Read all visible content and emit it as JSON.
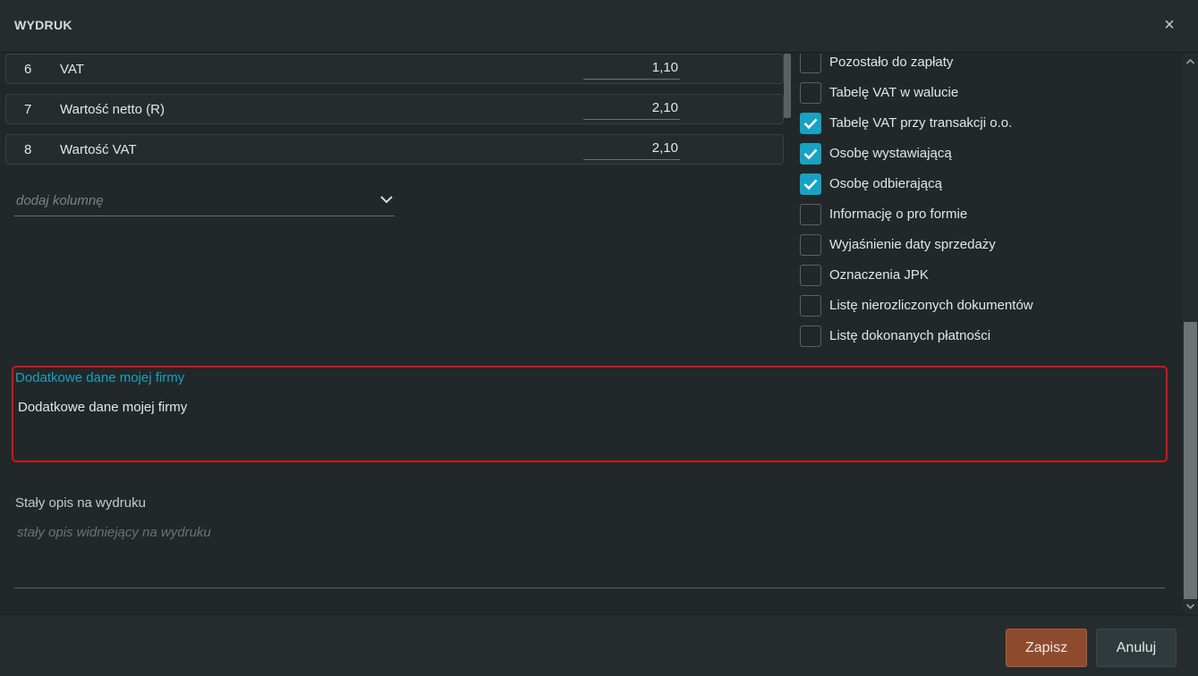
{
  "dialog": {
    "title": "WYDRUK",
    "close_label": "×"
  },
  "columns": [
    {
      "num": "6",
      "name": "VAT",
      "value": "1,10"
    },
    {
      "num": "7",
      "name": "Wartość netto (R)",
      "value": "2,10"
    },
    {
      "num": "8",
      "name": "Wartość VAT",
      "value": "2,10"
    }
  ],
  "add_column": {
    "placeholder": "dodaj kolumnę"
  },
  "checkboxes": [
    {
      "label": "Pozostało do zapłaty",
      "checked": false
    },
    {
      "label": "Tabelę VAT w walucie",
      "checked": false
    },
    {
      "label": "Tabelę VAT przy transakcji o.o.",
      "checked": true
    },
    {
      "label": "Osobę wystawiającą",
      "checked": true
    },
    {
      "label": "Osobę odbierającą",
      "checked": true
    },
    {
      "label": "Informację o pro formie",
      "checked": false
    },
    {
      "label": "Wyjaśnienie daty sprzedaży",
      "checked": false
    },
    {
      "label": "Oznaczenia JPK",
      "checked": false
    },
    {
      "label": "Listę nierozliczonych dokumentów",
      "checked": false
    },
    {
      "label": "Listę dokonanych płatności",
      "checked": false
    }
  ],
  "firm_data": {
    "label": "Dodatkowe dane mojej firmy",
    "value": "Dodatkowe dane mojej firmy"
  },
  "description": {
    "label": "Stały opis na wydruku",
    "placeholder": "stały opis widniejący na wydruku"
  },
  "footer": {
    "save_label": "Zapisz",
    "cancel_label": "Anuluj"
  },
  "colors": {
    "accent": "#17a2c3",
    "highlight_border": "#d2141c",
    "save_button": "#8f4b2e",
    "background": "#222829"
  }
}
